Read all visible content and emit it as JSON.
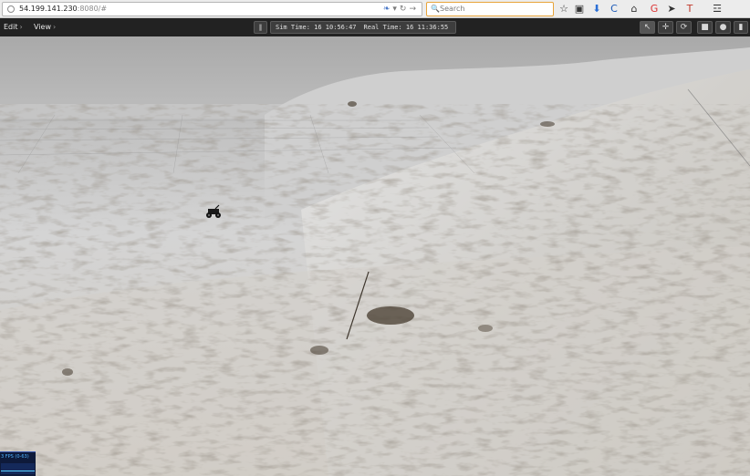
{
  "browser": {
    "url_host": "54.199.141.230",
    "url_port_path": ":8080/#",
    "search_placeholder": "Search",
    "search_glyph": "🔍",
    "url_actions": [
      "❧",
      "▾",
      "↻",
      "→"
    ],
    "toolbar_icons": [
      {
        "name": "bookmark-star-icon",
        "glyph": "☆"
      },
      {
        "name": "reading-list-icon",
        "glyph": "▣"
      },
      {
        "name": "downloads-icon",
        "glyph": "⬇"
      },
      {
        "name": "extension-c-icon",
        "glyph": "C"
      },
      {
        "name": "home-icon",
        "glyph": "⌂"
      },
      {
        "name": "extension-g-icon",
        "glyph": "G"
      },
      {
        "name": "send-icon",
        "glyph": "➤"
      },
      {
        "name": "extension-t-icon",
        "glyph": "T"
      },
      {
        "name": "tools-icon",
        "glyph": "☲"
      }
    ]
  },
  "app": {
    "menu_edit": "Edit",
    "menu_view": "View",
    "menu_chevron": "›",
    "play_glyph": "‖",
    "sim_time_label": "Sim Time:",
    "sim_time_value": "16 10:56:47",
    "real_time_label": "Real Time:",
    "real_time_value": "16 11:36:55",
    "tools": [
      {
        "name": "select-arrow-icon",
        "glyph": "↖"
      },
      {
        "name": "translate-icon",
        "glyph": "✛"
      },
      {
        "name": "rotate-icon",
        "glyph": "⟳"
      },
      {
        "name": "box-shape-icon",
        "glyph": "■"
      },
      {
        "name": "sphere-shape-icon",
        "glyph": "●"
      },
      {
        "name": "cylinder-shape-icon",
        "glyph": "▮"
      }
    ]
  },
  "scene": {
    "sky_color": "#b2b2b2",
    "terrain_light": "#d9d9d9",
    "terrain_dark": "#6e6558"
  },
  "stats": {
    "fps_text": "3 FPS (0-63)"
  }
}
